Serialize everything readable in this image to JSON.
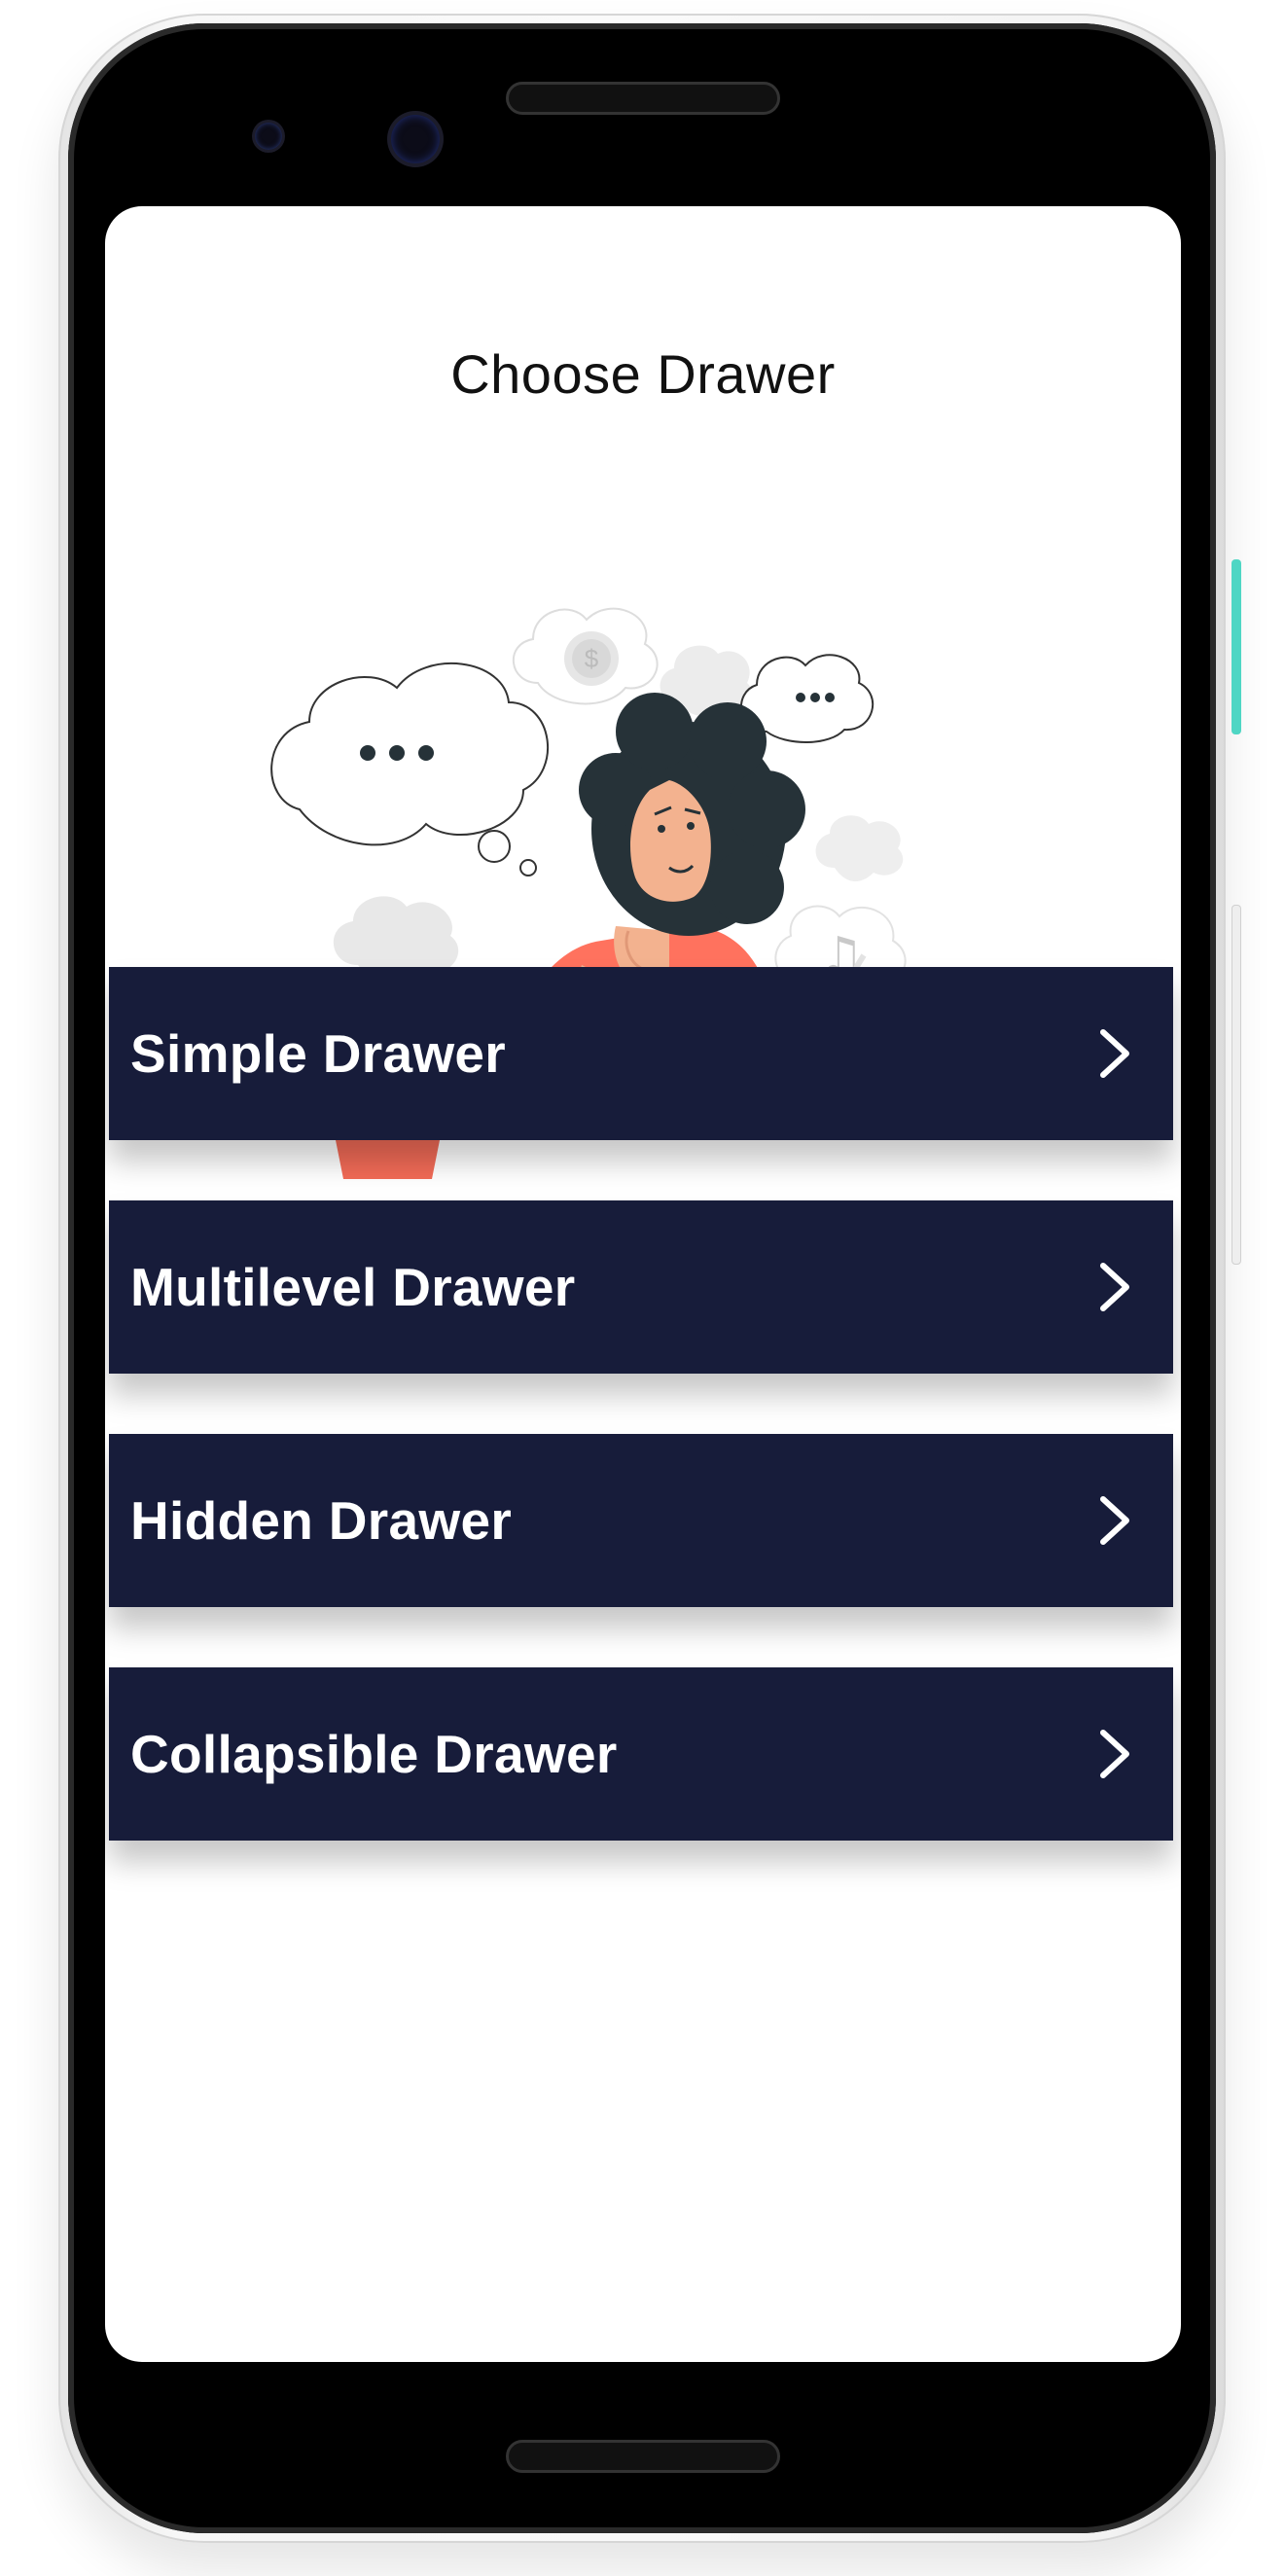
{
  "page": {
    "title": "Choose Drawer"
  },
  "menu": {
    "items": [
      {
        "label": "Simple Drawer",
        "icon": "chevron-right-icon"
      },
      {
        "label": "Multilevel Drawer",
        "icon": "chevron-right-icon"
      },
      {
        "label": "Hidden Drawer",
        "icon": "chevron-right-icon"
      },
      {
        "label": "Collapsible Drawer",
        "icon": "chevron-right-icon"
      }
    ]
  },
  "illustration": {
    "subject": "thinking-woman-illustration",
    "thought_bubble_text": "...",
    "coin_symbol": "$",
    "music_symbol": "♫"
  },
  "colors": {
    "menu_background": "#171c3a",
    "menu_text": "#ffffff",
    "accent_coral": "#ff725e",
    "cactus": "#2e4a53"
  }
}
